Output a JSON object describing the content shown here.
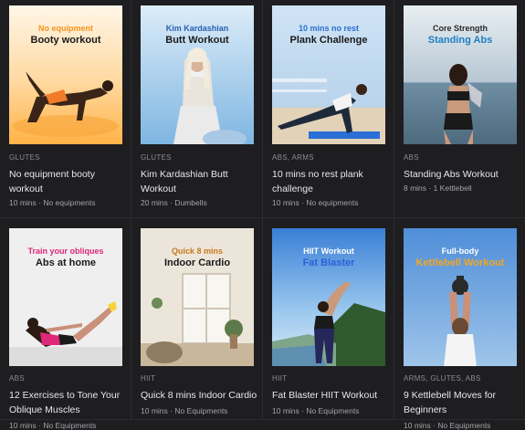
{
  "workouts": [
    {
      "thumb_line1": "No equipment",
      "thumb_line2": "Booty workout",
      "line1_color": "#f7931e",
      "line2_color": "#1a1a1a",
      "category": "GLUTES",
      "title": "No equipment booty workout",
      "meta": "10 mins · No equipments"
    },
    {
      "thumb_line1": "Kim Kardashian",
      "thumb_line2": "Butt Workout",
      "line1_color": "#2b5fb0",
      "line2_color": "#1a1a1a",
      "category": "GLUTES",
      "title": "Kim Kardashian Butt Workout",
      "meta": "20 mins · Dumbells"
    },
    {
      "thumb_line1": "10 mins no rest",
      "thumb_line2": "Plank Challenge",
      "line1_color": "#2b6fd0",
      "line2_color": "#1a1a1a",
      "category": "ABS, ARMS",
      "title": "10 mins no rest plank challenge",
      "meta": "10 mins · No equipments"
    },
    {
      "thumb_line1": "Core Strength",
      "thumb_line2": "Standing Abs",
      "line1_color": "#2a2a2a",
      "line2_color": "#1f7fc4",
      "category": "ABS",
      "title": "Standing Abs Workout",
      "meta": "8 mins · 1 Kettlebell"
    },
    {
      "thumb_line1": "Train your obliques",
      "thumb_line2": "Abs at home",
      "line1_color": "#e0287a",
      "line2_color": "#1a1a1a",
      "category": "ABS",
      "title": "12 Exercises to Tone Your Oblique Muscles",
      "meta": "10 mins · No Equipments"
    },
    {
      "thumb_line1": "Quick 8 mins",
      "thumb_line2": "Indoor Cardio",
      "line1_color": "#c9781e",
      "line2_color": "#1a1a1a",
      "category": "HIIT",
      "title": "Quick 8 mins Indoor Cardio",
      "meta": "10 mins · No Equipments"
    },
    {
      "thumb_line1": "HIIT Workout",
      "thumb_line2": "Fat Blaster",
      "line1_color": "#ffffff",
      "line2_color": "#2f5fd8",
      "category": "HIIT",
      "title": "Fat Blaster HIIT Workout",
      "meta": "10 mins · No Equipments"
    },
    {
      "thumb_line1": "Full-body",
      "thumb_line2": "Kettlebell Workout",
      "line1_color": "#ffffff",
      "line2_color": "#f4a623",
      "category": "ARMS, GLUTES, ABS",
      "title": "9 Kettlebell Moves for Beginners",
      "meta": "10 mins · No Equipments"
    }
  ]
}
